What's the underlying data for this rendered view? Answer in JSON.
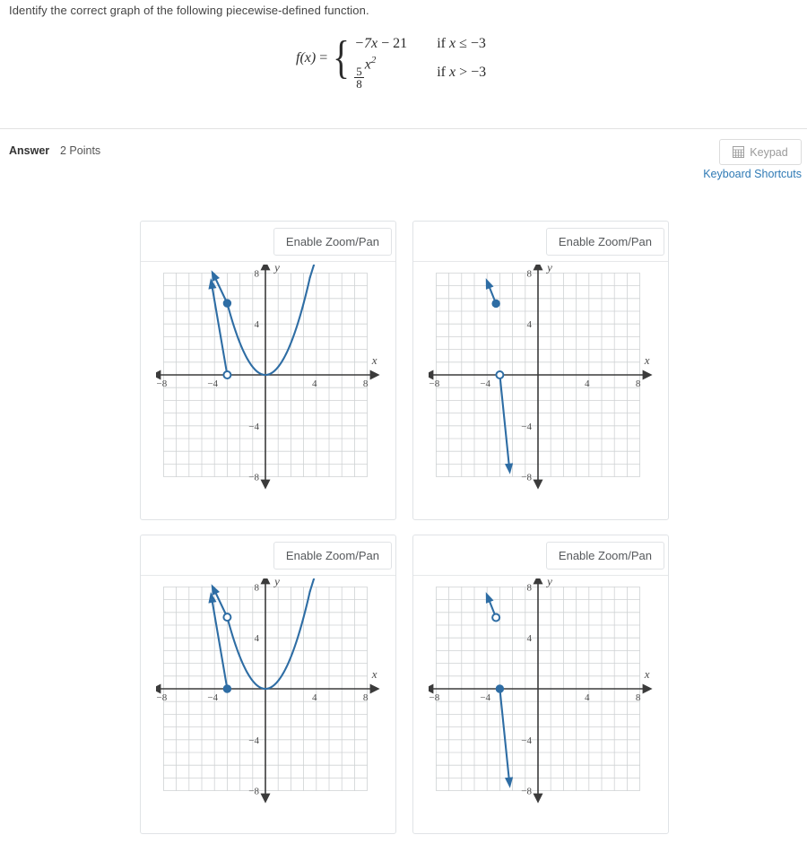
{
  "question": {
    "prompt": "Identify the correct graph of the following piecewise-defined function.",
    "formula": {
      "fx": "f(x)",
      "equals": "=",
      "case1_expr_a": "−7x − 21",
      "case1_cond_if": "if",
      "case1_cond_x": "x",
      "case1_cond_rest": "≤ −3",
      "case2_num": "5",
      "case2_den": "8",
      "case2_var": "x",
      "case2_exp": "2",
      "case2_cond_if": "if",
      "case2_cond_x": "x",
      "case2_cond_rest": "> −3"
    }
  },
  "answer_bar": {
    "label": "Answer",
    "points": "2 Points",
    "keypad_label": "Keypad",
    "keypad_icon": "keypad-grid-icon",
    "keyboard_shortcuts": "Keyboard Shortcuts",
    "link_color": "#2f7ab5"
  },
  "choices": [
    {
      "id": "A",
      "zoom_pan_label": "Enable Zoom/Pan"
    },
    {
      "id": "B",
      "zoom_pan_label": "Enable Zoom/Pan"
    },
    {
      "id": "C",
      "zoom_pan_label": "Enable Zoom/Pan"
    },
    {
      "id": "D",
      "zoom_pan_label": "Enable Zoom/Pan"
    }
  ],
  "chart_data": [
    {
      "id": "A",
      "type": "line",
      "title": "",
      "xlabel": "x",
      "ylabel": "y",
      "xlim": [
        -8,
        8
      ],
      "ylim": [
        -8,
        8
      ],
      "xticks": [
        -8,
        -4,
        4,
        8
      ],
      "yticks": [
        -8,
        -4,
        4,
        8
      ],
      "xtick_labels": [
        "−8",
        "−4",
        "4",
        "8"
      ],
      "ytick_labels": [
        "−8",
        "−4",
        "4",
        "8"
      ],
      "grid": true,
      "series": [
        {
          "name": "ray-linear",
          "kind": "segment-with-arrow",
          "from": [
            -3,
            0
          ],
          "to": [
            -4.3,
            7.6
          ],
          "endpoint_marker": "open-circle",
          "endpoint_at": [
            -3,
            0
          ],
          "arrow_at": "to"
        },
        {
          "name": "parabola",
          "kind": "quadratic",
          "coefficient": 0.625,
          "vertex": [
            0,
            0
          ],
          "x_start": -3,
          "x_end": 3.5,
          "endpoint_marker": "closed-circle",
          "endpoint_at": [
            -3,
            5.625
          ],
          "arrows": [
            "both-ends-up"
          ]
        }
      ],
      "color": "#2e6da4"
    },
    {
      "id": "B",
      "type": "line",
      "title": "",
      "xlabel": "x",
      "ylabel": "y",
      "xlim": [
        -8,
        8
      ],
      "ylim": [
        -8,
        8
      ],
      "xticks": [
        -8,
        -4,
        4,
        8
      ],
      "yticks": [
        -8,
        -4,
        4,
        8
      ],
      "xtick_labels": [
        "−8",
        "−4",
        "4",
        "8"
      ],
      "ytick_labels": [
        "−8",
        "−4",
        "4",
        "8"
      ],
      "grid": true,
      "series": [
        {
          "name": "upper-segment",
          "kind": "segment-with-arrow",
          "from": [
            -3.3,
            5.6
          ],
          "to": [
            -4.1,
            7.6
          ],
          "endpoint_marker": "closed-circle",
          "endpoint_at": [
            -3.3,
            5.6
          ],
          "arrow_at": "to"
        },
        {
          "name": "descending-ray",
          "kind": "segment-with-arrow",
          "from": [
            -3,
            0
          ],
          "to": [
            -2.2,
            -7.8
          ],
          "endpoint_marker": "open-circle",
          "endpoint_at": [
            -3,
            0
          ],
          "arrow_at": "to"
        }
      ],
      "color": "#2e6da4"
    },
    {
      "id": "C",
      "type": "line",
      "title": "",
      "xlabel": "x",
      "ylabel": "y",
      "xlim": [
        -8,
        8
      ],
      "ylim": [
        -8,
        8
      ],
      "xticks": [
        -8,
        -4,
        4,
        8
      ],
      "yticks": [
        -8,
        -4,
        4,
        8
      ],
      "xtick_labels": [
        "−8",
        "−4",
        "4",
        "8"
      ],
      "ytick_labels": [
        "−8",
        "−4",
        "4",
        "8"
      ],
      "grid": true,
      "series": [
        {
          "name": "ray-linear",
          "kind": "segment-with-arrow",
          "from": [
            -3,
            0
          ],
          "to": [
            -4.3,
            7.6
          ],
          "endpoint_marker": "closed-circle",
          "endpoint_at": [
            -3,
            0
          ],
          "arrow_at": "to"
        },
        {
          "name": "parabola",
          "kind": "quadratic",
          "coefficient": 0.625,
          "vertex": [
            0,
            0
          ],
          "x_start": -3,
          "x_end": 3.5,
          "endpoint_marker": "open-circle",
          "endpoint_at": [
            -3,
            5.625
          ],
          "arrows": [
            "both-ends-up"
          ]
        }
      ],
      "color": "#2e6da4"
    },
    {
      "id": "D",
      "type": "line",
      "title": "",
      "xlabel": "x",
      "ylabel": "y",
      "xlim": [
        -8,
        8
      ],
      "ylim": [
        -8,
        8
      ],
      "xticks": [
        -8,
        -4,
        4,
        8
      ],
      "yticks": [
        -8,
        -4,
        4,
        8
      ],
      "xtick_labels": [
        "−8",
        "−4",
        "4",
        "8"
      ],
      "ytick_labels": [
        "−8",
        "−4",
        "4",
        "8"
      ],
      "grid": true,
      "series": [
        {
          "name": "upper-segment",
          "kind": "segment-with-arrow",
          "from": [
            -3.3,
            5.6
          ],
          "to": [
            -4.1,
            7.6
          ],
          "endpoint_marker": "open-circle",
          "endpoint_at": [
            -3.3,
            5.6
          ],
          "arrow_at": "to"
        },
        {
          "name": "descending-ray",
          "kind": "segment-with-arrow",
          "from": [
            -3,
            0
          ],
          "to": [
            -2.2,
            -7.8
          ],
          "endpoint_marker": "closed-circle",
          "endpoint_at": [
            -3,
            0
          ],
          "arrow_at": "to"
        }
      ],
      "color": "#2e6da4"
    }
  ]
}
